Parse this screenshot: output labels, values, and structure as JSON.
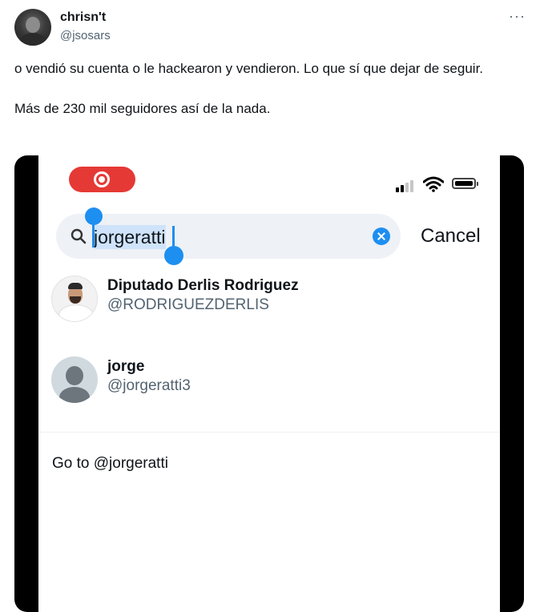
{
  "tweet": {
    "display_name": "chrisn't",
    "handle": "@jsosars",
    "more_icon": "···",
    "text_line1": "o vendió su cuenta o le hackearon y vendieron. Lo que sí que dejar de seguir.",
    "text_line2": "Más de 230 mil seguidores así de la nada."
  },
  "phone": {
    "search": {
      "query": "jorgeratti",
      "cancel_label": "Cancel"
    },
    "results": [
      {
        "name": "Diputado Derlis Rodriguez",
        "handle": "@RODRIGUEZDERLIS"
      },
      {
        "name": "jorge",
        "handle": "@jorgeratti3"
      }
    ],
    "goto_label": "Go to @jorgeratti"
  },
  "colors": {
    "accent": "#1d8ff1",
    "record": "#e53935",
    "secondary_text": "#536471"
  }
}
